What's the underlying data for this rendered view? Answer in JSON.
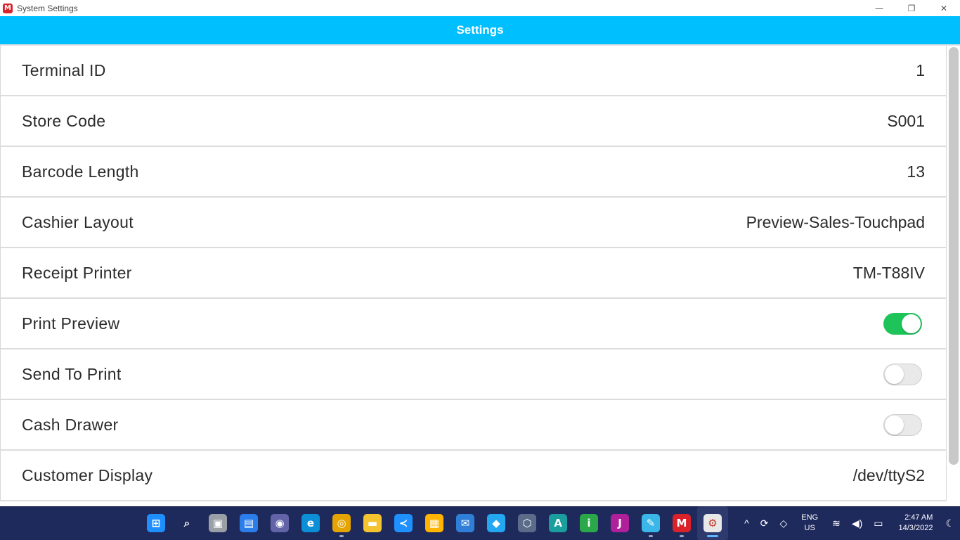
{
  "window": {
    "title": "System Settings",
    "app_icon_letter": "M",
    "minimize": "—",
    "maximize": "❐",
    "close": "✕"
  },
  "header": {
    "title": "Settings"
  },
  "settings": [
    {
      "label": "Terminal ID",
      "value": "1"
    },
    {
      "label": "Store Code",
      "value": "S001"
    },
    {
      "label": "Barcode Length",
      "value": "13"
    },
    {
      "label": "Cashier Layout",
      "value": "Preview-Sales-Touchpad"
    },
    {
      "label": "Receipt Printer",
      "value": "TM-T88IV"
    },
    {
      "label": "Print Preview",
      "toggle": true
    },
    {
      "label": "Send To Print",
      "toggle": false
    },
    {
      "label": "Cash Drawer",
      "toggle": false
    },
    {
      "label": "Customer Display",
      "value": "/dev/ttyS2"
    }
  ],
  "colors": {
    "header": "#00bfff",
    "toggle_on": "#1ec45a",
    "taskbar": "#1f2a5c"
  },
  "taskbar": {
    "apps": [
      {
        "name": "start-icon",
        "glyph": "⊞",
        "color": "#1f8fff"
      },
      {
        "name": "search-icon",
        "glyph": "⌕",
        "color": "transparent"
      },
      {
        "name": "task-view-icon",
        "glyph": "▣",
        "color": "#9aa0a6"
      },
      {
        "name": "widgets-icon",
        "glyph": "▤",
        "color": "#2b7de9"
      },
      {
        "name": "chat-icon",
        "glyph": "◉",
        "color": "#6264a7"
      },
      {
        "name": "edge-icon",
        "glyph": "e",
        "color": "#0c8fd6"
      },
      {
        "name": "chrome-icon",
        "glyph": "◎",
        "color": "#e6a400"
      },
      {
        "name": "file-explorer-icon",
        "glyph": "▬",
        "color": "#f4c430"
      },
      {
        "name": "vscode-icon",
        "glyph": "≺",
        "color": "#1e90ff"
      },
      {
        "name": "store-icon",
        "glyph": "▦",
        "color": "#ffb400"
      },
      {
        "name": "mail-icon",
        "glyph": "✉",
        "color": "#2f7fd8"
      },
      {
        "name": "maps-icon",
        "glyph": "◆",
        "color": "#22a7f0"
      },
      {
        "name": "virtualbox-icon",
        "glyph": "⬡",
        "color": "#5a6c8a"
      },
      {
        "name": "a-app-icon",
        "glyph": "A",
        "color": "#1a9e9e"
      },
      {
        "name": "i-app-icon",
        "glyph": "i",
        "color": "#2aa84a"
      },
      {
        "name": "j-app-icon",
        "glyph": "J",
        "color": "#b0209a"
      },
      {
        "name": "paint-icon",
        "glyph": "✎",
        "color": "#3bb6e8"
      },
      {
        "name": "m-app-icon",
        "glyph": "M",
        "color": "#d9222a"
      },
      {
        "name": "settings-app-icon",
        "glyph": "⚙",
        "color": "#e8e8e8"
      }
    ],
    "tray": {
      "chevron": "^",
      "sync": "⟳",
      "dropbox": "◇",
      "lang_top": "ENG",
      "lang_bottom": "US",
      "wifi": "≋",
      "volume": "◀)",
      "battery": "▭",
      "time": "2:47 AM",
      "date": "14/3/2022",
      "night": "☾"
    }
  }
}
